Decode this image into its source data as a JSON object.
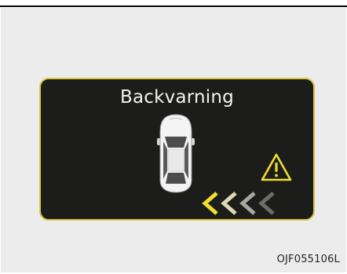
{
  "panel": {
    "title": "Backvarning"
  },
  "figure": {
    "code": "OJF055106L"
  },
  "icons": {
    "car": "car-top-view-icon",
    "warning": "warning-triangle-icon",
    "proximity": "rear-proximity-chevrons"
  },
  "colors": {
    "panel_background": "#1c1d1b",
    "panel_border": "#d9c63a",
    "warning_yellow": "#f0de2e",
    "chevron_shades": [
      "#f0de2e",
      "#dcd9b4",
      "#a8a79e",
      "#6c6c68"
    ]
  }
}
